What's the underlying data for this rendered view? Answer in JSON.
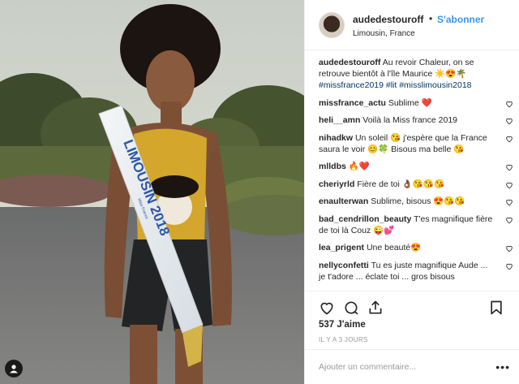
{
  "header": {
    "username": "audedestouroff",
    "separator": "•",
    "follow_label": "S'abonner",
    "location": "Limousin, France"
  },
  "photo": {
    "sash_text": "LIMOUSIN 2018",
    "sash_small_text": "Miss France"
  },
  "caption": {
    "username": "audedestouroff",
    "text": "Au revoir Chaleur, on se retrouve bientôt à l'île Maurice ☀️😍🌴",
    "hashtags": "#missfrance2019 #lit #misslimousin2018"
  },
  "comments": [
    {
      "user": "missfrance_actu",
      "text": "Sublime ❤️"
    },
    {
      "user": "heli__amn",
      "text": "Voilà la Miss france 2019"
    },
    {
      "user": "nihadkw",
      "text": "Un soleil 😘 j'espère que la France saura le voir 😊🍀 Bisous ma belle 😘"
    },
    {
      "user": "mlldbs",
      "text": "🔥❤️"
    },
    {
      "user": "cheriyrld",
      "text": "Fière de toi 👌🏾😘😘😘"
    },
    {
      "user": "enaulterwan",
      "text": "Sublime, bisous 😍😘😘"
    },
    {
      "user": "bad_cendrillon_beauty",
      "text": "T'es magnifique fière de toi là Couz 😜💕"
    },
    {
      "user": "lea_prigent",
      "text": "Une beauté😍"
    },
    {
      "user": "nellyconfetti",
      "text": "Tu es juste magnifique Aude ... je t'adore ... éclate toi ... gros bisous"
    }
  ],
  "likes": "537 J'aime",
  "timestamp": "IL Y A 3 JOURS",
  "add_comment_placeholder": "Ajouter un commentaire...",
  "more_options": "•••",
  "colors": {
    "link_blue": "#3897f0",
    "hashtag_blue": "#003569",
    "text": "#262626",
    "muted": "#999999",
    "border": "#efefef"
  },
  "icons": [
    "user-tag-icon",
    "heart-icon",
    "comment-icon",
    "share-icon",
    "bookmark-icon",
    "more-options-icon"
  ]
}
